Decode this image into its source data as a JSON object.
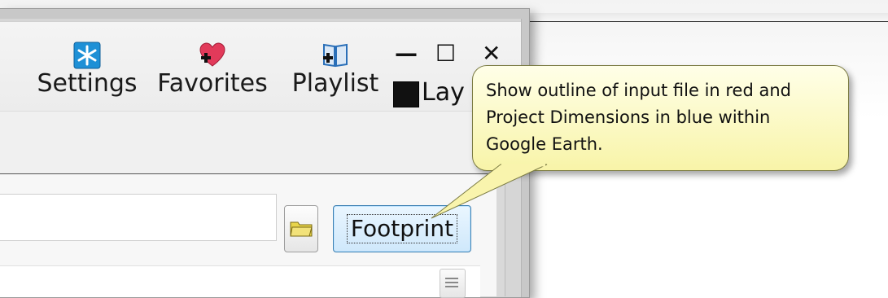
{
  "toolbar": {
    "settings_label": "Settings",
    "favorites_label": "Favorites",
    "playlist_label": "Playlist",
    "layers_label_partial": "Lay"
  },
  "window_controls": {
    "minimize": "—",
    "maximize": "☐",
    "close": "✕"
  },
  "input": {
    "value": ""
  },
  "footprint_button": {
    "label": "Footprint"
  },
  "tooltip": {
    "line1": "Show outline of input file in red and",
    "line2": "Project Dimensions in blue within",
    "line3": "Google Earth."
  },
  "colors": {
    "tooltip_bg": "#ffffe8",
    "tooltip_border": "#7b7b43",
    "footprint_focus": "#3c7fb1",
    "settings_icon": "#1e90d6",
    "favorites_icon": "#e23a5a",
    "playlist_icon": "#2a6fb8"
  },
  "icons": {
    "settings": "settings-snowflake-icon",
    "favorites": "heart-plus-icon",
    "playlist": "book-plus-icon",
    "layers": "black-square-icon",
    "browse": "folder-icon"
  }
}
